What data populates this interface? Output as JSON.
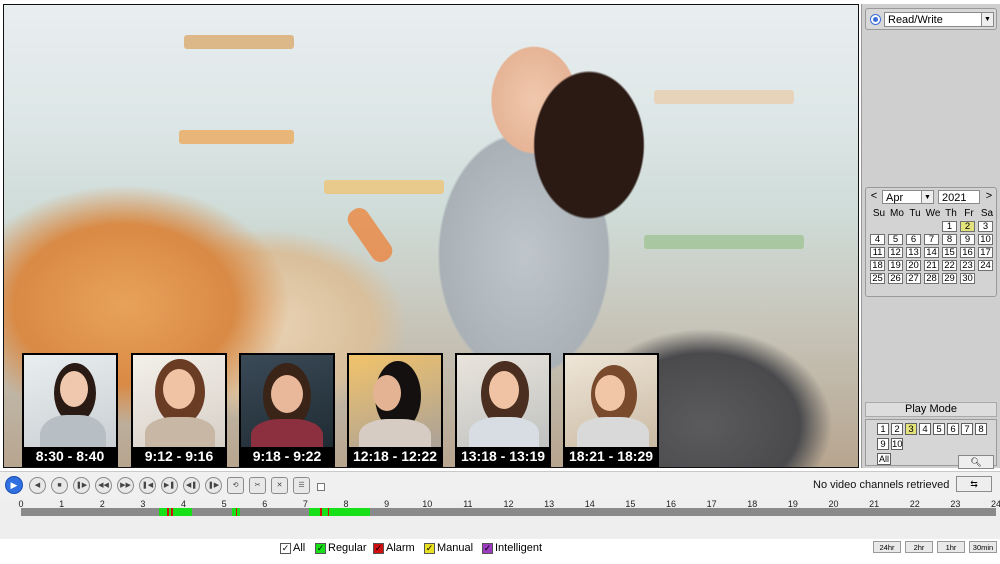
{
  "panel": {
    "mode_select": "Read/Write",
    "calendar": {
      "month": "Apr",
      "year": "2021",
      "prev": "<",
      "next": ">",
      "weekdays": [
        "Su",
        "Mo",
        "Tu",
        "We",
        "Th",
        "Fr",
        "Sa"
      ],
      "days": [
        "1",
        "2",
        "3",
        "4",
        "5",
        "6",
        "7",
        "8",
        "9",
        "10",
        "11",
        "12",
        "13",
        "14",
        "15",
        "16",
        "17",
        "18",
        "19",
        "20",
        "21",
        "22",
        "23",
        "24",
        "25",
        "26",
        "27",
        "28",
        "29",
        "30"
      ],
      "first_weekday_index": 4,
      "selected_day": "2",
      "recorded_days": [
        "2"
      ]
    },
    "play_mode": {
      "title": "Play Mode",
      "channels": [
        "1",
        "2",
        "3",
        "4",
        "5",
        "6",
        "7",
        "8",
        "9",
        "10"
      ],
      "selected_channel": "3",
      "all_label": "All",
      "search_icon": "search-icon"
    }
  },
  "thumbnails": [
    {
      "time": "8:30 - 8:40"
    },
    {
      "time": "9:12 - 9:16"
    },
    {
      "time": "9:18 - 9:22"
    },
    {
      "time": "12:18 - 12:22"
    },
    {
      "time": "13:18 - 13:19"
    },
    {
      "time": "18:21 - 18:29"
    }
  ],
  "controls": {
    "status_text": "No video channels retrieved",
    "buttons": [
      "play",
      "rewind",
      "stop",
      "pause",
      "fast-rewind",
      "fast-forward",
      "step-back",
      "step-forward",
      "prev-file",
      "next-file",
      "backup",
      "clip",
      "close",
      "list"
    ]
  },
  "timeline": {
    "hours": [
      "0",
      "1",
      "2",
      "3",
      "4",
      "5",
      "6",
      "7",
      "8",
      "9",
      "10",
      "11",
      "12",
      "13",
      "14",
      "15",
      "16",
      "17",
      "18",
      "19",
      "20",
      "21",
      "22",
      "23",
      "24"
    ],
    "segments": [
      {
        "start": 3.4,
        "end": 4.2,
        "color": "#18e018"
      },
      {
        "start": 3.6,
        "end": 3.65,
        "color": "#d01010"
      },
      {
        "start": 3.7,
        "end": 3.75,
        "color": "#d01010"
      },
      {
        "start": 5.2,
        "end": 5.4,
        "color": "#18e018"
      },
      {
        "start": 5.28,
        "end": 5.31,
        "color": "#d01010"
      },
      {
        "start": 7.1,
        "end": 8.6,
        "color": "#18e018"
      },
      {
        "start": 7.35,
        "end": 7.4,
        "color": "#d01010"
      },
      {
        "start": 7.55,
        "end": 7.58,
        "color": "#d01010"
      }
    ]
  },
  "legend": {
    "items": [
      {
        "label": "All",
        "color": "#ffffff"
      },
      {
        "label": "Regular",
        "color": "#18e018"
      },
      {
        "label": "Alarm",
        "color": "#d01010"
      },
      {
        "label": "Manual",
        "color": "#e8e020"
      },
      {
        "label": "Intelligent",
        "color": "#9b3bc0"
      }
    ],
    "zoom": [
      "24hr",
      "2hr",
      "1hr",
      "30min"
    ]
  }
}
